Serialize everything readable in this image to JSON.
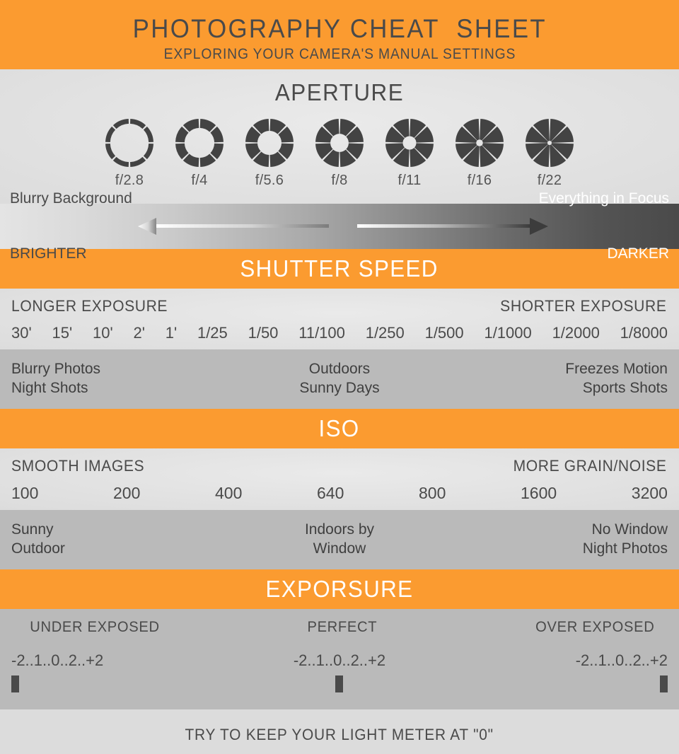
{
  "header": {
    "title": "PHOTOGRAPHY CHEAT  SHEET",
    "subtitle": "EXPLORING YOUR CAMERA'S MANUAL SETTINGS"
  },
  "colors": {
    "accent_orange": "#fb9b30",
    "band_light": "#e3e3e3",
    "band_mid": "#bababa",
    "text_dark": "#4a4a4a",
    "text_white": "#ffffff"
  },
  "aperture": {
    "heading": "APERTURE",
    "stops": [
      {
        "label": "f/2.8",
        "opening": 0.8
      },
      {
        "label": "f/4",
        "opening": 0.62
      },
      {
        "label": "f/5.6",
        "opening": 0.5
      },
      {
        "label": "f/8",
        "opening": 0.38
      },
      {
        "label": "f/11",
        "opening": 0.28
      },
      {
        "label": "f/16",
        "opening": 0.14
      },
      {
        "label": "f/22",
        "opening": 0.09
      }
    ],
    "gradient_bar": {
      "left_line1": "Blurry Background",
      "left_line2": "BRIGHTER",
      "right_line1": "Everything in Focus",
      "right_line2": "DARKER",
      "left_arrow_direction": "left",
      "right_arrow_direction": "right"
    }
  },
  "shutter": {
    "heading": "SHUTTER SPEED",
    "end_label_left": "LONGER EXPOSURE",
    "end_label_right": "SHORTER EXPOSURE",
    "values": [
      "30'",
      "15'",
      "10'",
      "2'",
      "1'",
      "1/25",
      "1/50",
      "11/100",
      "1/250",
      "1/500",
      "1/1000",
      "1/2000",
      "1/8000"
    ],
    "descriptions": {
      "left": "Blurry Photos\nNight Shots",
      "center": "Outdoors\nSunny Days",
      "right": "Freezes Motion\nSports Shots"
    }
  },
  "iso": {
    "heading": "ISO",
    "end_label_left": "SMOOTH IMAGES",
    "end_label_right": "MORE GRAIN/NOISE",
    "values": [
      "100",
      "200",
      "400",
      "640",
      "800",
      "1600",
      "3200"
    ],
    "descriptions": {
      "left": "Sunny\nOutdoor",
      "center": "Indoors by\nWindow",
      "right": "No Window\nNight Photos"
    }
  },
  "exposure": {
    "heading": "EXPORSURE",
    "labels": {
      "left": "UNDER EXPOSED",
      "center": "PERFECT",
      "right": "OVER EXPOSED"
    },
    "meters": [
      {
        "name": "under-exposed",
        "scale": "-2..1..0..2..+2",
        "marker_position": 0.0
      },
      {
        "name": "perfect",
        "scale": "-2..1..0..2..+2",
        "marker_position": 0.5
      },
      {
        "name": "over-exposed",
        "scale": "-2..1..0..2..+2",
        "marker_position": 1.0
      }
    ]
  },
  "footer": {
    "text": "TRY TO KEEP YOUR LIGHT METER AT \"0\""
  }
}
